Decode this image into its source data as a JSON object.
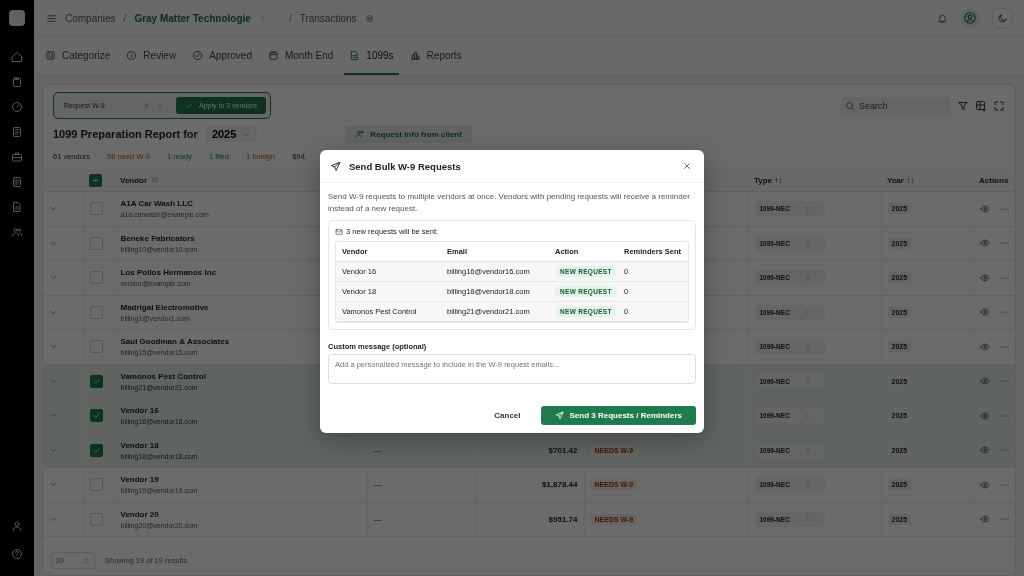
{
  "breadcrumb": {
    "root": "Companies",
    "separator_1": "/",
    "company": "Gray Matter Technologie",
    "separator_2": "/",
    "page": "Transactions"
  },
  "tabs": [
    {
      "label": "Categorize",
      "selected": false
    },
    {
      "label": "Review",
      "selected": false
    },
    {
      "label": "Approved",
      "selected": false
    },
    {
      "label": "Month End",
      "selected": false
    },
    {
      "label": "1099s",
      "selected": true
    },
    {
      "label": "Reports",
      "selected": false
    }
  ],
  "toolbar": {
    "action_select": "Request W-9",
    "apply_button": "Apply to 3 vendors",
    "search_placeholder": "Search"
  },
  "report": {
    "title": "1099 Preparation Report for",
    "year": "2025",
    "request_button": "Request info from client"
  },
  "stats": [
    {
      "text": "61 vendors",
      "kind": "neutral"
    },
    {
      "text": "58 need W-9",
      "kind": "warning"
    },
    {
      "text": "1 ready",
      "kind": "success"
    },
    {
      "text": "1 filed",
      "kind": "success"
    },
    {
      "text": "1 foreign",
      "kind": "warning"
    },
    {
      "text": "$94,",
      "kind": "neutral"
    }
  ],
  "table": {
    "header_checkbox": {
      "indeterminate": true
    },
    "columns": [
      "Vendor",
      "Type ↑↓",
      "Year ↑↓",
      "Actions"
    ],
    "rows": [
      {
        "name": "A1A Car Wash LLC",
        "email": "a1a.carwash@example.com",
        "selected": false,
        "type": "1099-NEC",
        "year": "2025"
      },
      {
        "name": "Beneke Fabricators",
        "email": "billing10@vendor10.com",
        "selected": false,
        "type": "1099-NEC",
        "year": "2025"
      },
      {
        "name": "Los Pollos Hermanos Inc",
        "email": "vendor@example.com",
        "selected": false,
        "type": "1099-NEC",
        "year": "2025"
      },
      {
        "name": "Madrigal Electromotive",
        "email": "billing1@vendor1.com",
        "selected": false,
        "type": "1099-NEC",
        "year": "2025"
      },
      {
        "name": "Saul Goodman & Associates",
        "email": "billing15@vendor15.com",
        "selected": false,
        "type": "1099-NEC",
        "year": "2025"
      },
      {
        "name": "Vamonos Pest Control",
        "email": "billing21@vendor21.com",
        "selected": true,
        "type": "1099-NEC",
        "year": "2025"
      },
      {
        "name": "Vendor 16",
        "email": "billing16@vendor16.com",
        "selected": true,
        "type": "1099-NEC",
        "year": "2025"
      },
      {
        "name": "Vendor 18",
        "email": "billing18@vendor18.com",
        "selected": true,
        "column_4": "—",
        "amount": "$701.42",
        "status": "NEEDS W-9",
        "type": "1099-NEC",
        "year": "2025"
      },
      {
        "name": "Vendor 19",
        "email": "billing19@vendor19.com",
        "selected": false,
        "column_4": "—",
        "amount": "$1,878.44",
        "status": "NEEDS W-9",
        "type": "1099-NEC",
        "year": "2025"
      },
      {
        "name": "Vendor 20",
        "email": "billing20@vendor20.com",
        "selected": false,
        "column_4": "—",
        "amount": "$951.74",
        "status": "NEEDS W-9",
        "type": "1099-NEC",
        "year": "2025"
      }
    ]
  },
  "footer": {
    "page_size": "20",
    "summary": "Showing 19 of 19 results"
  },
  "modal": {
    "title": "Send Bulk W-9 Requests",
    "description": "Send W-9 requests to multiple vendors at once. Vendors with pending requests will receive a reminder instead of a new request.",
    "summary": "3 new requests will be sent:",
    "columns": [
      "Vendor",
      "Email",
      "Action",
      "Reminders Sent"
    ],
    "rows": [
      {
        "vendor": "Vendor 16",
        "email": "billing16@vendor16.com",
        "action": "NEW REQUEST",
        "reminders": "0"
      },
      {
        "vendor": "Vendor 18",
        "email": "billing18@vendor18.com",
        "action": "NEW REQUEST",
        "reminders": "0"
      },
      {
        "vendor": "Vamonos Pest Control",
        "email": "billing21@vendor21.com",
        "action": "NEW REQUEST",
        "reminders": "0"
      }
    ],
    "message_label": "Custom message (optional)",
    "message_placeholder": "Add a personalized message to include in the W-9 request emails...",
    "cancel_button": "Cancel",
    "submit_button": "Send 3 Requests / Reminders"
  }
}
